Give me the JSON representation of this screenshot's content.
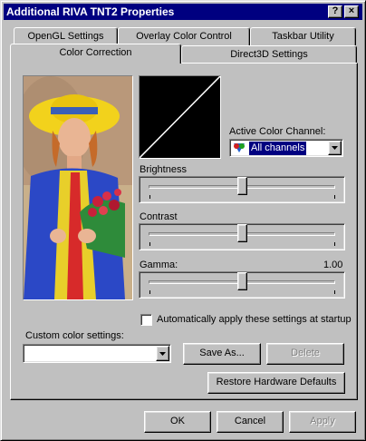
{
  "window": {
    "title": "Additional RIVA TNT2 Properties",
    "help_label": "?",
    "close_label": "×"
  },
  "tabs": {
    "row1": [
      "OpenGL Settings",
      "Overlay Color Control",
      "Taskbar Utility"
    ],
    "row2": [
      "Color Correction",
      "Direct3D Settings"
    ],
    "active": "Color Correction"
  },
  "color_correction": {
    "active_channel_label": "Active Color Channel:",
    "active_channel_value": "All channels",
    "brightness_label": "Brightness",
    "contrast_label": "Contrast",
    "gamma_label": "Gamma:",
    "gamma_value": "1.00",
    "brightness_level": 0.5,
    "contrast_level": 0.5,
    "gamma_level": 0.5,
    "auto_apply_label": "Automatically apply these settings at startup",
    "auto_apply_checked": false,
    "custom_settings_label": "Custom color settings:",
    "custom_settings_value": "",
    "save_as_label": "Save As...",
    "delete_label": "Delete",
    "restore_label": "Restore Hardware Defaults"
  },
  "footer": {
    "ok_label": "OK",
    "cancel_label": "Cancel",
    "apply_label": "Apply"
  },
  "colors": {
    "titlebar": "#000080",
    "selection": "#000080",
    "face": "#c0c0c0"
  }
}
